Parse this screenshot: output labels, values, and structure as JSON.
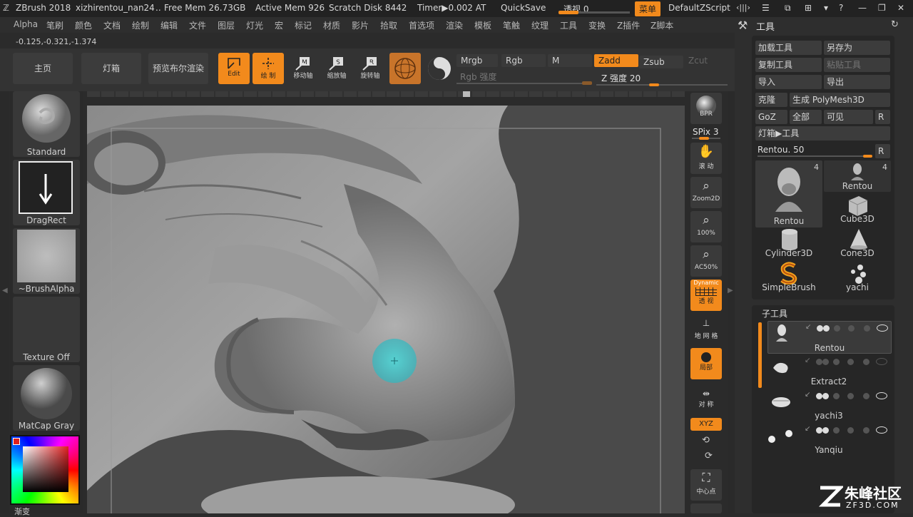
{
  "titlebar": {
    "app": "ZBrush 2018",
    "file": "xizhirentou_nan24",
    "dots": "..",
    "free_mem": "Free Mem 26.73GB",
    "active_mem": "Active Mem 926",
    "scratch": "Scratch Disk 8442",
    "timer": "Timer▶0.002 AT",
    "quicksave": "QuickSave",
    "perspective": "透视 0",
    "menu": "菜单",
    "script": "DefaultZScript"
  },
  "menubar": {
    "items": [
      "Alpha",
      "笔刷",
      "颜色",
      "文档",
      "绘制",
      "编辑",
      "文件",
      "图层",
      "灯光",
      "宏",
      "标记",
      "材质",
      "影片",
      "拾取",
      "首选项",
      "渲染",
      "模板",
      "笔触",
      "纹理",
      "工具",
      "变换",
      "Z插件",
      "Z脚本"
    ]
  },
  "coords": "-0.125,-0.321,-1.374",
  "topshelf": {
    "home": "主页",
    "lightbox": "灯箱",
    "preview_render": "预览布尔渲染",
    "edit": "Edit",
    "draw": "绘 制",
    "move": "移动轴",
    "scale": "缩放轴",
    "rotate": "旋转轴",
    "mrgb": "Mrgb",
    "rgb": "Rgb",
    "m": "M",
    "zadd": "Zadd",
    "zsub": "Zsub",
    "zcut": "Zcut",
    "rgb_intensity": "Rgb 强度",
    "z_intensity": "Z 强度 20"
  },
  "leftshelf": {
    "brush": "Standard",
    "stroke": "DragRect",
    "alpha": "~BrushAlpha",
    "texture": "Texture Off",
    "material": "MatCap Gray",
    "gradient": "渐变"
  },
  "rightshelf": {
    "bpr": "BPR",
    "spix": "SPix 3",
    "scroll": "滚 动",
    "zoom2d": "Zoom2D",
    "zoom100": "100%",
    "ac50": "AC50%",
    "dynamic": "Dynamic",
    "persp": "透 视",
    "floor": "地 网 格",
    "local": "局部",
    "sym": "对 称",
    "xyz": "XYZ",
    "center": "中心点"
  },
  "toolpanel": {
    "title": "工具",
    "load": "加载工具",
    "save_as": "另存为",
    "copy": "复制工具",
    "paste": "粘贴工具",
    "import": "导入",
    "export": "导出",
    "clone": "克隆",
    "make_polymesh": "生成 PolyMesh3D",
    "goz": "GoZ",
    "all": "全部",
    "visible": "可见",
    "r": "R",
    "lightbox_tool": "灯箱▶工具",
    "rentou_slider": "Rentou. 50",
    "tools": [
      {
        "name": "Rentou",
        "count": "4"
      },
      {
        "name": "Rentou",
        "count": "4"
      },
      {
        "name": "Cube3D"
      },
      {
        "name": "Cylinder3D"
      },
      {
        "name": "Cone3D"
      },
      {
        "name": "SimpleBrush"
      },
      {
        "name": "yachi"
      }
    ]
  },
  "subtool": {
    "title": "子工具",
    "items": [
      "Rentou",
      "Extract2",
      "yachi3",
      "Yanqiu"
    ]
  },
  "watermark": {
    "cn": "朱峰社区",
    "url": "ZF3D.COM"
  }
}
